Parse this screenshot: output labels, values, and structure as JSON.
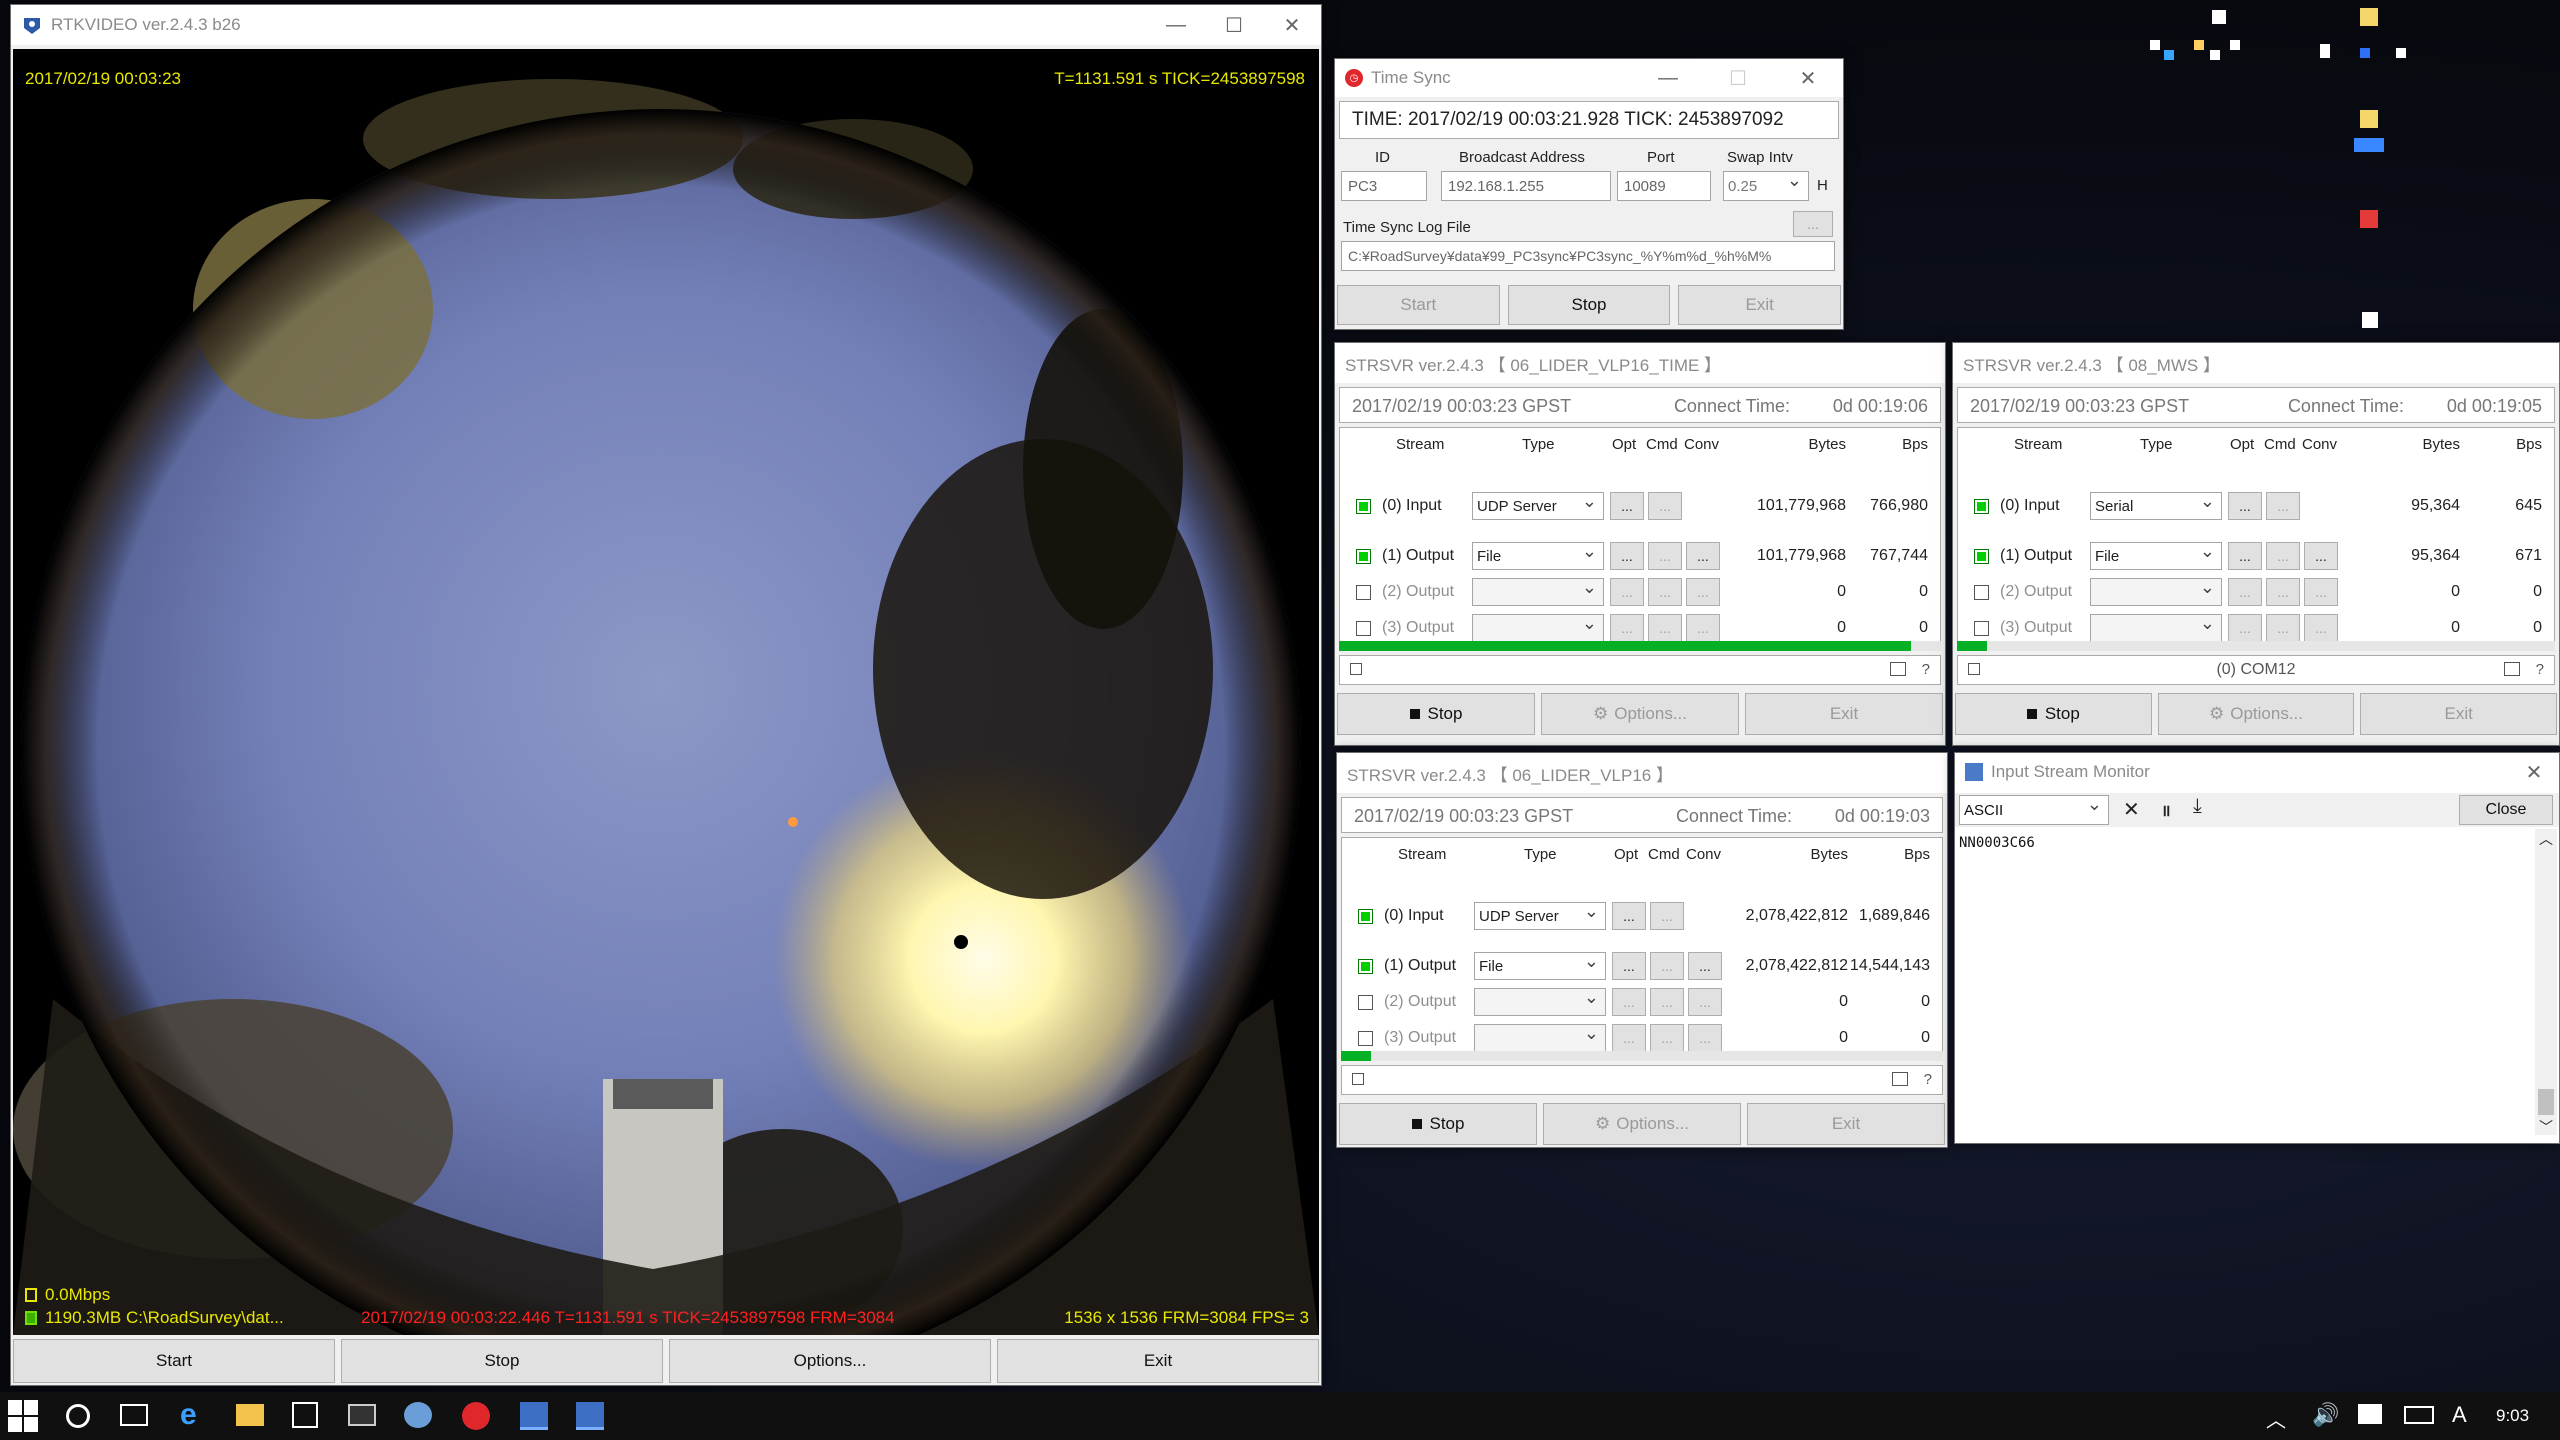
{
  "rtkvideo": {
    "title": "RTKVIDEO ver.2.4.3 b26",
    "overlay_time": "2017/02/19 00:03:23",
    "overlay_tick": "T=1131.591 s TICK=2453897598",
    "rate": "0.0Mbps",
    "file_info": "1190.3MB C:\\RoadSurvey\\dat...",
    "frame_status": "2017/02/19 00:03:22.446 T=1131.591 s TICK=2453897598 FRM=3084",
    "resolution": "1536 x 1536 FRM=3084 FPS= 3",
    "buttons": {
      "start": "Start",
      "stop": "Stop",
      "options": "Options...",
      "exit": "Exit"
    }
  },
  "timesync": {
    "title": "Time Sync",
    "time_line": "TIME: 2017/02/19 00:03:21.928  TICK: 2453897092",
    "labels": {
      "id": "ID",
      "broadcast": "Broadcast Address",
      "port": "Port",
      "swap": "Swap Intv",
      "h": "H",
      "log": "Time Sync Log File",
      "browse": "..."
    },
    "values": {
      "id": "PC3",
      "broadcast": "192.168.1.255",
      "port": "10089",
      "swap": "0.25",
      "log": "C:¥RoadSurvey¥data¥99_PC3sync¥PC3sync_%Y%m%d_%h%M%"
    },
    "buttons": {
      "start": "Start",
      "stop": "Stop",
      "exit": "Exit"
    }
  },
  "strsvr_headers": {
    "stream": "Stream",
    "type": "Type",
    "opt": "Opt",
    "cmd": "Cmd",
    "conv": "Conv",
    "bytes": "Bytes",
    "bps": "Bps",
    "dots": "...",
    "question": "?"
  },
  "strsvr1": {
    "title": "STRSVR ver.2.4.3 【 06_LIDER_VLP16_TIME 】",
    "time": "2017/02/19 00:03:23 GPST",
    "connect_label": "Connect Time:",
    "connect_value": "0d 00:19:06",
    "rows": [
      {
        "label": "(0) Input",
        "type": "UDP Server",
        "bytes": "101,779,968",
        "bps": "766,980"
      },
      {
        "label": "(1) Output",
        "type": "File",
        "bytes": "101,779,968",
        "bps": "767,744"
      },
      {
        "label": "(2) Output",
        "type": "",
        "bytes": "0",
        "bps": "0"
      },
      {
        "label": "(3) Output",
        "type": "",
        "bytes": "0",
        "bps": "0"
      }
    ],
    "progress": 0.95,
    "status_text": "",
    "buttons": {
      "stop": "Stop",
      "options": "Options...",
      "exit": "Exit"
    }
  },
  "strsvr2": {
    "title": "STRSVR ver.2.4.3 【 08_MWS 】",
    "time": "2017/02/19 00:03:23 GPST",
    "connect_label": "Connect Time:",
    "connect_value": "0d 00:19:05",
    "rows": [
      {
        "label": "(0) Input",
        "type": "Serial",
        "bytes": "95,364",
        "bps": "645"
      },
      {
        "label": "(1) Output",
        "type": "File",
        "bytes": "95,364",
        "bps": "671"
      },
      {
        "label": "(2) Output",
        "type": "",
        "bytes": "0",
        "bps": "0"
      },
      {
        "label": "(3) Output",
        "type": "",
        "bytes": "0",
        "bps": "0"
      }
    ],
    "progress": 0.05,
    "status_text": "(0) COM12",
    "buttons": {
      "stop": "Stop",
      "options": "Options...",
      "exit": "Exit"
    }
  },
  "strsvr3": {
    "title": "STRSVR ver.2.4.3 【 06_LIDER_VLP16 】",
    "time": "2017/02/19 00:03:23 GPST",
    "connect_label": "Connect Time:",
    "connect_value": "0d 00:19:03",
    "rows": [
      {
        "label": "(0) Input",
        "type": "UDP Server",
        "bytes": "2,078,422,812",
        "bps": "1,689,846"
      },
      {
        "label": "(1) Output",
        "type": "File",
        "bytes": "2,078,422,812",
        "bps": "14,544,143"
      },
      {
        "label": "(2) Output",
        "type": "",
        "bytes": "0",
        "bps": "0"
      },
      {
        "label": "(3) Output",
        "type": "",
        "bytes": "0",
        "bps": "0"
      }
    ],
    "progress": 0.05,
    "status_text": "",
    "buttons": {
      "stop": "Stop",
      "options": "Options...",
      "exit": "Exit"
    }
  },
  "monitor": {
    "title": "Input Stream Monitor",
    "format": "ASCII",
    "close": "Close",
    "content": "NN0003C66"
  },
  "taskbar": {
    "clock": "9:03",
    "ime": "A"
  },
  "colors": {
    "status_green": "#00d000",
    "overlay_yellow": "#e8e800",
    "overlay_red": "#ff2020",
    "accent": "#0078d7"
  }
}
